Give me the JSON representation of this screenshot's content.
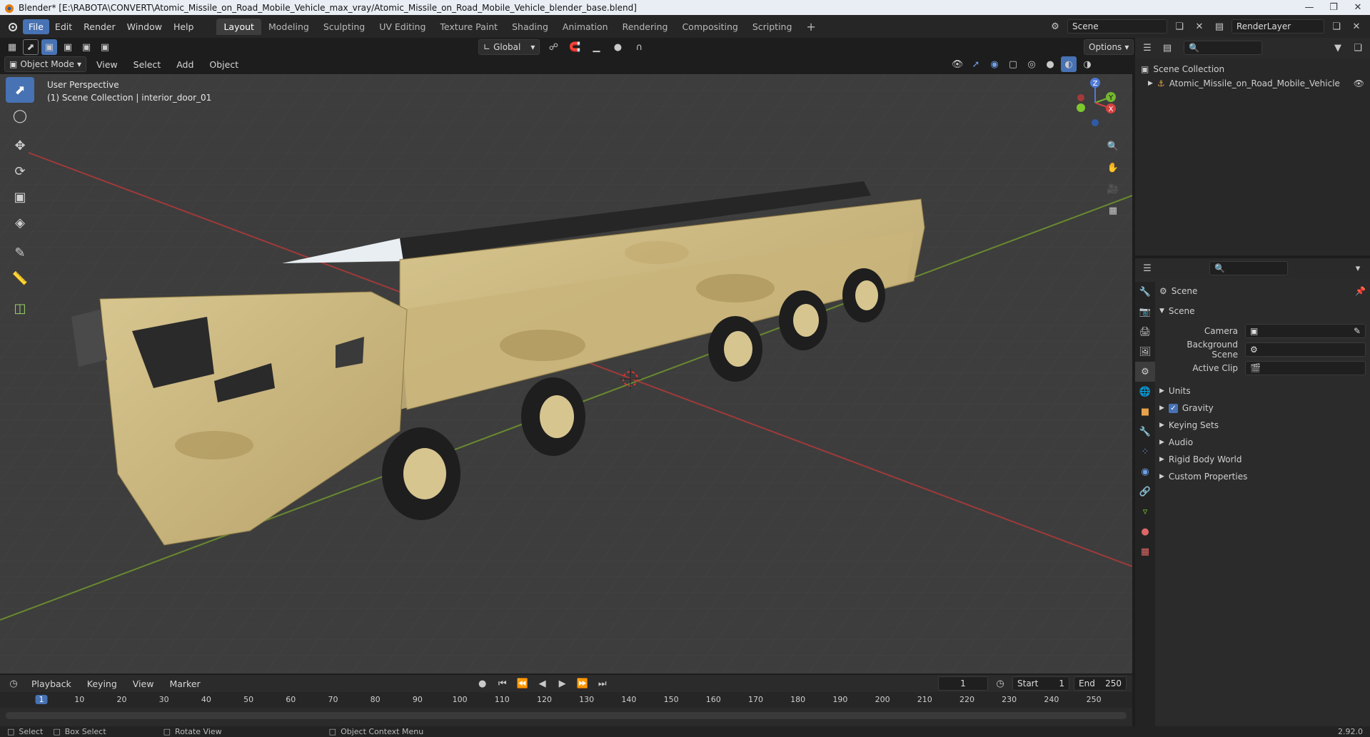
{
  "window": {
    "title": "Blender* [E:\\RABOTA\\CONVERT\\Atomic_Missile_on_Road_Mobile_Vehicle_max_vray/Atomic_Missile_on_Road_Mobile_Vehicle_blender_base.blend]"
  },
  "menu": [
    "File",
    "Edit",
    "Render",
    "Window",
    "Help"
  ],
  "workspaces": [
    "Layout",
    "Modeling",
    "Sculpting",
    "UV Editing",
    "Texture Paint",
    "Shading",
    "Animation",
    "Rendering",
    "Compositing",
    "Scripting"
  ],
  "top_right": {
    "scene": "Scene",
    "view_layer": "RenderLayer"
  },
  "viewport_header": {
    "mode": "Object Mode",
    "menus": [
      "View",
      "Select",
      "Add",
      "Object"
    ],
    "transform_orientation": "Global",
    "options": "Options"
  },
  "viewport": {
    "perspective": "User Perspective",
    "collection_info": "(1) Scene Collection | interior_door_01",
    "gizmo_axes": [
      "Z",
      "Y",
      "X"
    ]
  },
  "outliner": {
    "root": "Scene Collection",
    "items": [
      {
        "label": "Atomic_Missile_on_Road_Mobile_Vehicle"
      }
    ]
  },
  "properties": {
    "header": "Scene",
    "panel": "Scene",
    "fields": [
      {
        "label": "Camera",
        "value": ""
      },
      {
        "label": "Background Scene",
        "value": ""
      },
      {
        "label": "Active Clip",
        "value": ""
      }
    ],
    "sections": [
      "Units",
      "Gravity",
      "Keying Sets",
      "Audio",
      "Rigid Body World",
      "Custom Properties"
    ],
    "gravity_checked": true
  },
  "timeline": {
    "menus": [
      "Playback",
      "Keying",
      "View",
      "Marker"
    ],
    "current_frame": "1",
    "start_label": "Start",
    "start": "1",
    "end_label": "End",
    "end": "250",
    "ruler": [
      "1",
      "10",
      "20",
      "30",
      "40",
      "50",
      "60",
      "70",
      "80",
      "90",
      "100",
      "110",
      "120",
      "130",
      "140",
      "150",
      "160",
      "170",
      "180",
      "190",
      "200",
      "210",
      "220",
      "230",
      "240",
      "250"
    ]
  },
  "statusbar": {
    "items": [
      "Select",
      "Box Select",
      "Rotate View",
      "Object Context Menu"
    ],
    "version": "2.92.0"
  }
}
